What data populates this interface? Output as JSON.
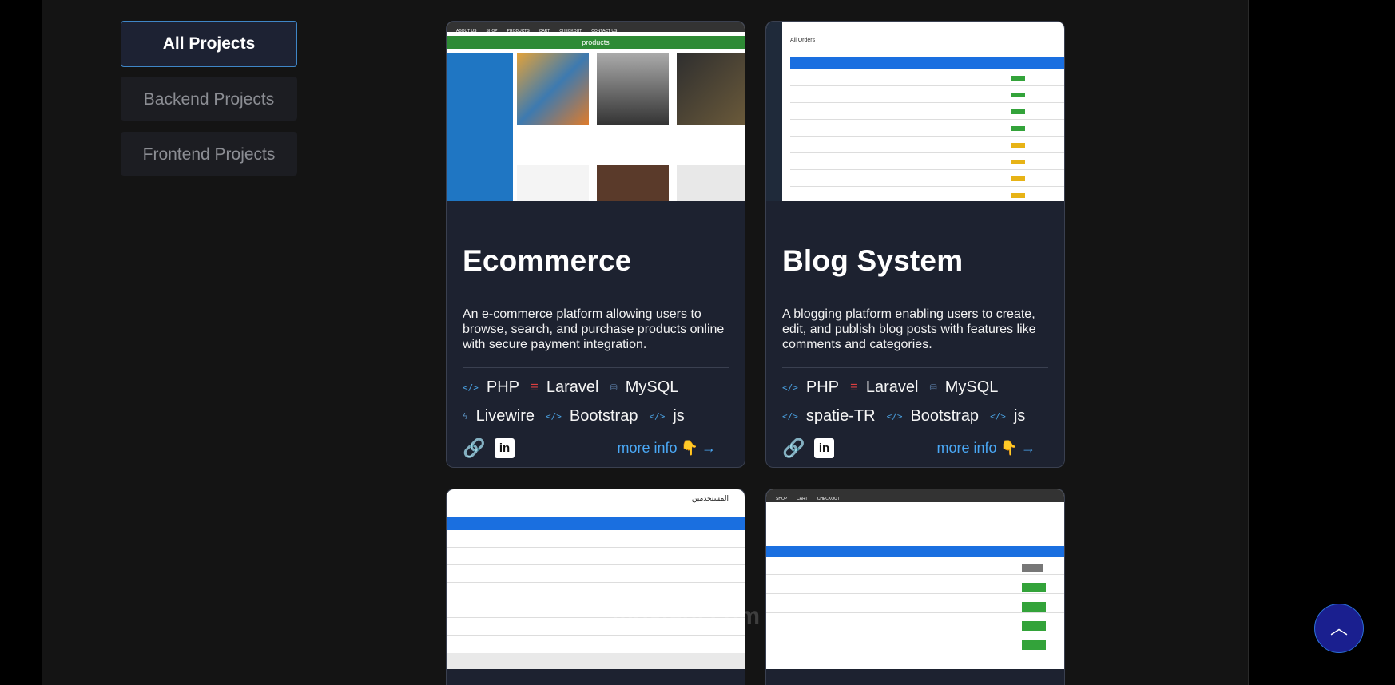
{
  "filters": [
    {
      "label": "All Projects",
      "active": true
    },
    {
      "label": "Backend Projects",
      "active": false
    },
    {
      "label": "Frontend Projects",
      "active": false
    }
  ],
  "projects": [
    {
      "title": "Ecommerce",
      "description": "An e-commerce platform allowing users to browse, search, and purchase products online with secure payment integration.",
      "tags": [
        {
          "label": "PHP",
          "icon": "code-icon"
        },
        {
          "label": "Laravel",
          "icon": "stack-icon"
        },
        {
          "label": "MySQL",
          "icon": "database-icon"
        },
        {
          "label": "Livewire",
          "icon": "bolt-icon"
        },
        {
          "label": "Bootstrap",
          "icon": "code-icon"
        },
        {
          "label": "js",
          "icon": "code-icon"
        }
      ],
      "more_info": "more info",
      "thumb_label": "products"
    },
    {
      "title": "Blog System",
      "description": "A blogging platform enabling users to create, edit, and publish blog posts with features like comments and categories.",
      "tags": [
        {
          "label": "PHP",
          "icon": "code-icon"
        },
        {
          "label": "Laravel",
          "icon": "stack-icon"
        },
        {
          "label": "MySQL",
          "icon": "database-icon"
        },
        {
          "label": "spatie-TR",
          "icon": "code-icon"
        },
        {
          "label": "Bootstrap",
          "icon": "code-icon"
        },
        {
          "label": "js",
          "icon": "code-icon"
        }
      ],
      "more_info": "more info",
      "thumb_label": "All Orders"
    }
  ],
  "thumb3_title": "المستخدمين",
  "thumb4_nav": [
    "SHOP",
    "CART",
    "CHECKOUT"
  ],
  "watermark": "mostaql.com",
  "scroll_top_icon": "chevron-up-icon",
  "colors": {
    "accent": "#4aa8f5",
    "card_bg": "#1d2230",
    "scroll_btn": "#1a1f8f"
  }
}
